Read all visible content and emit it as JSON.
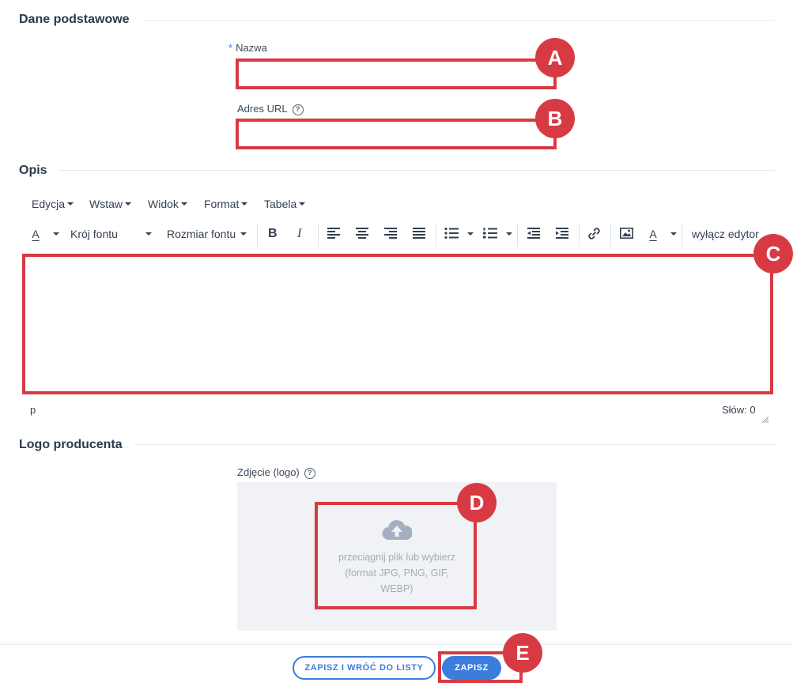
{
  "sections": {
    "basic": "Dane podstawowe",
    "description": "Opis",
    "logo": "Logo producenta"
  },
  "fields": {
    "name": {
      "required_mark": "*",
      "label": "Nazwa",
      "value": ""
    },
    "url": {
      "label": "Adres URL",
      "help_icon": "question-circle-icon",
      "help_glyph": "?",
      "value": ""
    },
    "photo": {
      "label": "Zdjęcie (logo)",
      "help_icon": "question-circle-icon",
      "help_glyph": "?"
    }
  },
  "editor": {
    "menus": [
      "Edycja",
      "Wstaw",
      "Widok",
      "Format",
      "Tabela"
    ],
    "toolbar": {
      "font_color": "A",
      "font_family": "Krój fontu",
      "font_size": "Rozmiar fontu",
      "bold": "B",
      "italic": "I",
      "bg_color": "A",
      "disable_editor": "wyłącz edytor"
    },
    "content": "",
    "status_path": "p",
    "word_count": "Słów: 0"
  },
  "dropzone": {
    "icon": "cloud-upload-icon",
    "line1": "przeciągnij plik lub wybierz",
    "line2": "(format JPG, PNG, GIF,",
    "line3": "WEBP)"
  },
  "footer": {
    "save_and_back": "ZAPISZ I WRÓĆ DO LISTY",
    "save": "ZAPISZ"
  },
  "annotations": [
    "A",
    "B",
    "C",
    "D",
    "E"
  ],
  "colors": {
    "accent": "#3b7ddd",
    "annotation": "#d83a44",
    "dropzone_bg": "#f0f2f6"
  }
}
